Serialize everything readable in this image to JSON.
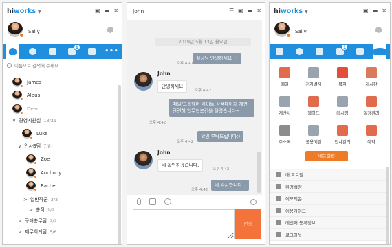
{
  "panel1": {
    "logo_hi": "hi",
    "logo_works": "works",
    "user": "Sally",
    "search_placeholder": "이름으로 검색해 주세요.",
    "tabs_badge": "1",
    "tree": [
      {
        "name": "James",
        "type": "person"
      },
      {
        "name": "Albus",
        "type": "person"
      },
      {
        "name": "Dean",
        "type": "person",
        "muted": true
      },
      {
        "name": "경영지원실",
        "count": "18/21",
        "type": "group",
        "open": true
      },
      {
        "name": "Luke",
        "type": "person"
      },
      {
        "name": "인사B팀",
        "count": "7/8",
        "type": "group",
        "open": true
      },
      {
        "name": "Zoe",
        "type": "person"
      },
      {
        "name": "Anchony",
        "type": "person"
      },
      {
        "name": "Rachel",
        "type": "person"
      },
      {
        "name": "일반작군",
        "count": "3/3",
        "type": "group"
      },
      {
        "name": "총직",
        "count": "1/2",
        "type": "group"
      },
      {
        "name": "구매총무팀",
        "count": "2/2",
        "type": "group"
      },
      {
        "name": "재무회계팀",
        "count": "5/6",
        "type": "group"
      }
    ]
  },
  "chat": {
    "title": "John",
    "date": "2019년 5월 13일 월요일",
    "messages": [
      {
        "from": "me",
        "text": "실장님 안녕하세요~!",
        "time": "오후 4:41"
      },
      {
        "from": "John",
        "text": "안녕하세요",
        "time": "오후 4:42"
      },
      {
        "from": "me",
        "text": "메일/그룹웨어 사이트 상품페이지 개편 관련해 업무협조건을 올렸습니다~",
        "time": "오후 4:42"
      },
      {
        "from": "me",
        "text": "확인 부탁드립니다:)",
        "time": "오후 4:42"
      },
      {
        "from": "John",
        "text": "네 확인하겠습니다.",
        "time": "오후 4:42"
      },
      {
        "from": "me",
        "text": "네 감사합니다~",
        "time": "오후 4:42"
      }
    ],
    "sender_name": "John",
    "send_label": "전송"
  },
  "panel3": {
    "logo_hi": "hi",
    "logo_works": "works",
    "user": "Sally",
    "tabs_badge": "1",
    "menu": [
      {
        "label": "메일",
        "color": "#e26b4d"
      },
      {
        "label": "전자결재",
        "color": "#9aa4ae"
      },
      {
        "label": "목지",
        "color": "#e24e3a"
      },
      {
        "label": "게시판",
        "color": "#d97b5a"
      },
      {
        "label": "계산서",
        "color": "#9aa4ae"
      },
      {
        "label": "웹하드",
        "color": "#e26b4d"
      },
      {
        "label": "메시징",
        "color": "#9aa4ae"
      },
      {
        "label": "일정관리",
        "color": "#e26b4d"
      },
      {
        "label": "주소록",
        "color": "#8c8c8c"
      },
      {
        "label": "공용메일",
        "color": "#9aa4ae"
      },
      {
        "label": "인사관리",
        "color": "#e26b4d"
      },
      {
        "label": "예약",
        "color": "#e26b4d"
      }
    ],
    "settings_button": "메뉴설정",
    "links": [
      "내 프로필",
      "환경설정",
      "이모티콘",
      "이용가이드",
      "메신저 등록정보",
      "로그아웃"
    ]
  }
}
